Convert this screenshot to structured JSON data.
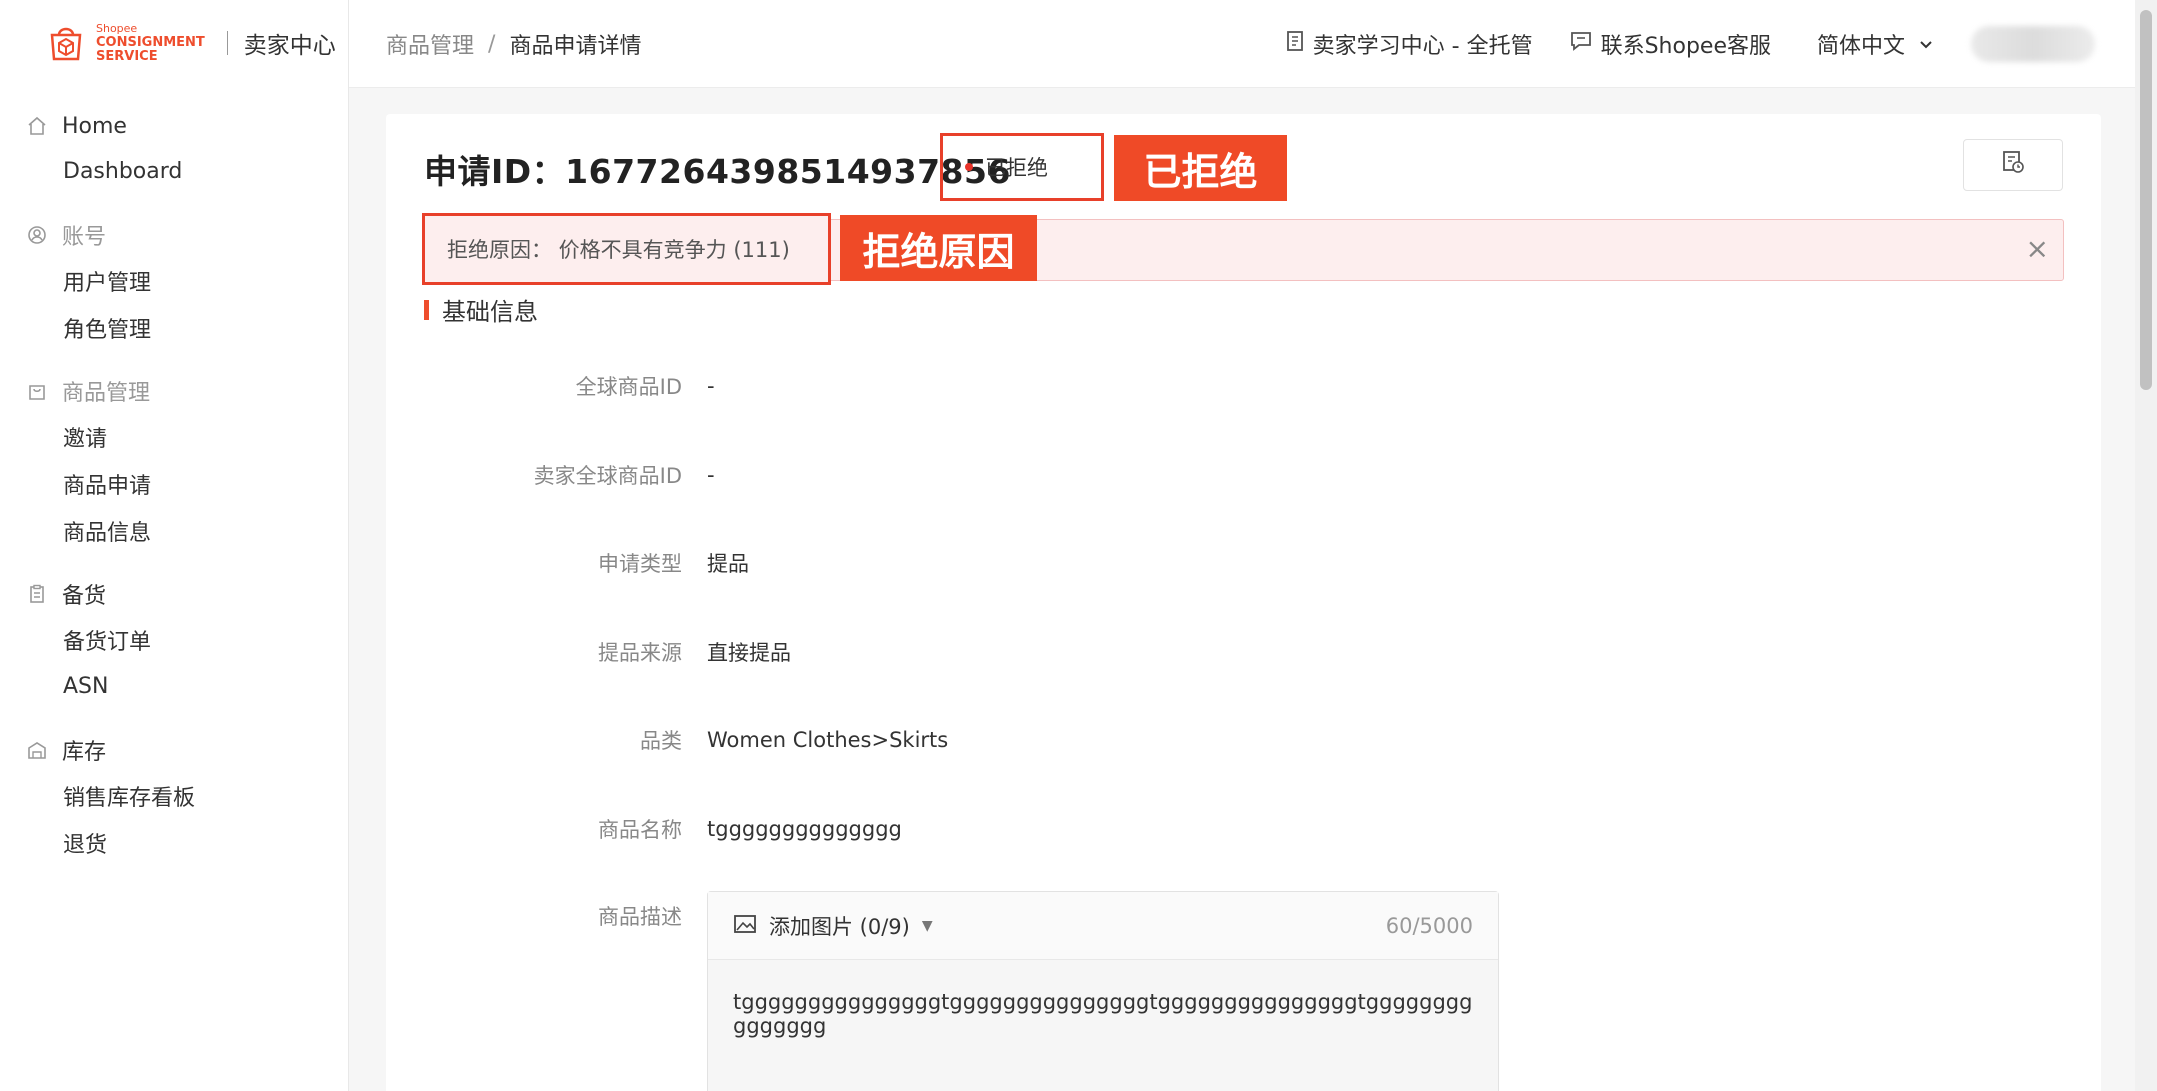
{
  "brand": {
    "logo_line1": "Shopee",
    "logo_line2": "CONSIGNMENT",
    "logo_line3": "SERVICE",
    "title": "卖家中心"
  },
  "sidebar": {
    "groups": [
      {
        "head": "Home",
        "icon": "home-icon",
        "muted": false,
        "items": [
          "Dashboard"
        ]
      },
      {
        "head": "账号",
        "icon": "user-circle-icon",
        "muted": true,
        "items": [
          "用户管理",
          "角色管理"
        ]
      },
      {
        "head": "商品管理",
        "icon": "bag-icon",
        "muted": true,
        "items": [
          "邀请",
          "商品申请",
          "商品信息"
        ]
      },
      {
        "head": "备货",
        "icon": "clipboard-icon",
        "muted": false,
        "items": [
          "备货订单",
          "ASN"
        ]
      },
      {
        "head": "库存",
        "icon": "warehouse-icon",
        "muted": false,
        "items": [
          "销售库存看板",
          "退货"
        ]
      }
    ]
  },
  "header": {
    "breadcrumb": [
      "商品管理",
      "商品申请详情"
    ],
    "learning_center": "卖家学习中心 - 全托管",
    "contact": "联系Shopee客服",
    "language": "简体中文"
  },
  "detail": {
    "title": "申请ID：1677264398514937856",
    "status": "已拒绝",
    "annotation_status": "已拒绝",
    "reject_reason": "拒绝原因： 价格不具有竞争力 (111)",
    "annotation_reason": "拒绝原因",
    "section_title": "基础信息",
    "fields": [
      {
        "label": "全球商品ID",
        "value": "-"
      },
      {
        "label": "卖家全球商品ID",
        "value": "-"
      },
      {
        "label": "申请类型",
        "value": "提品"
      },
      {
        "label": "提品来源",
        "value": "直接提品"
      },
      {
        "label": "品类",
        "value": "Women Clothes>Skirts"
      },
      {
        "label": "商品名称",
        "value": "tgggggggggggggg"
      }
    ],
    "description_label": "商品描述",
    "description_toolbar": "添加图片 (0/9)",
    "description_counter": "60/5000",
    "description_text": "tgggggggggggggggtgggggggggggggggtgggggggggggggggtggggggggggggggg"
  },
  "colors": {
    "brand": "#ee4d2d",
    "annotation": "#ef4a27",
    "reject_bg": "#fdeeee"
  }
}
